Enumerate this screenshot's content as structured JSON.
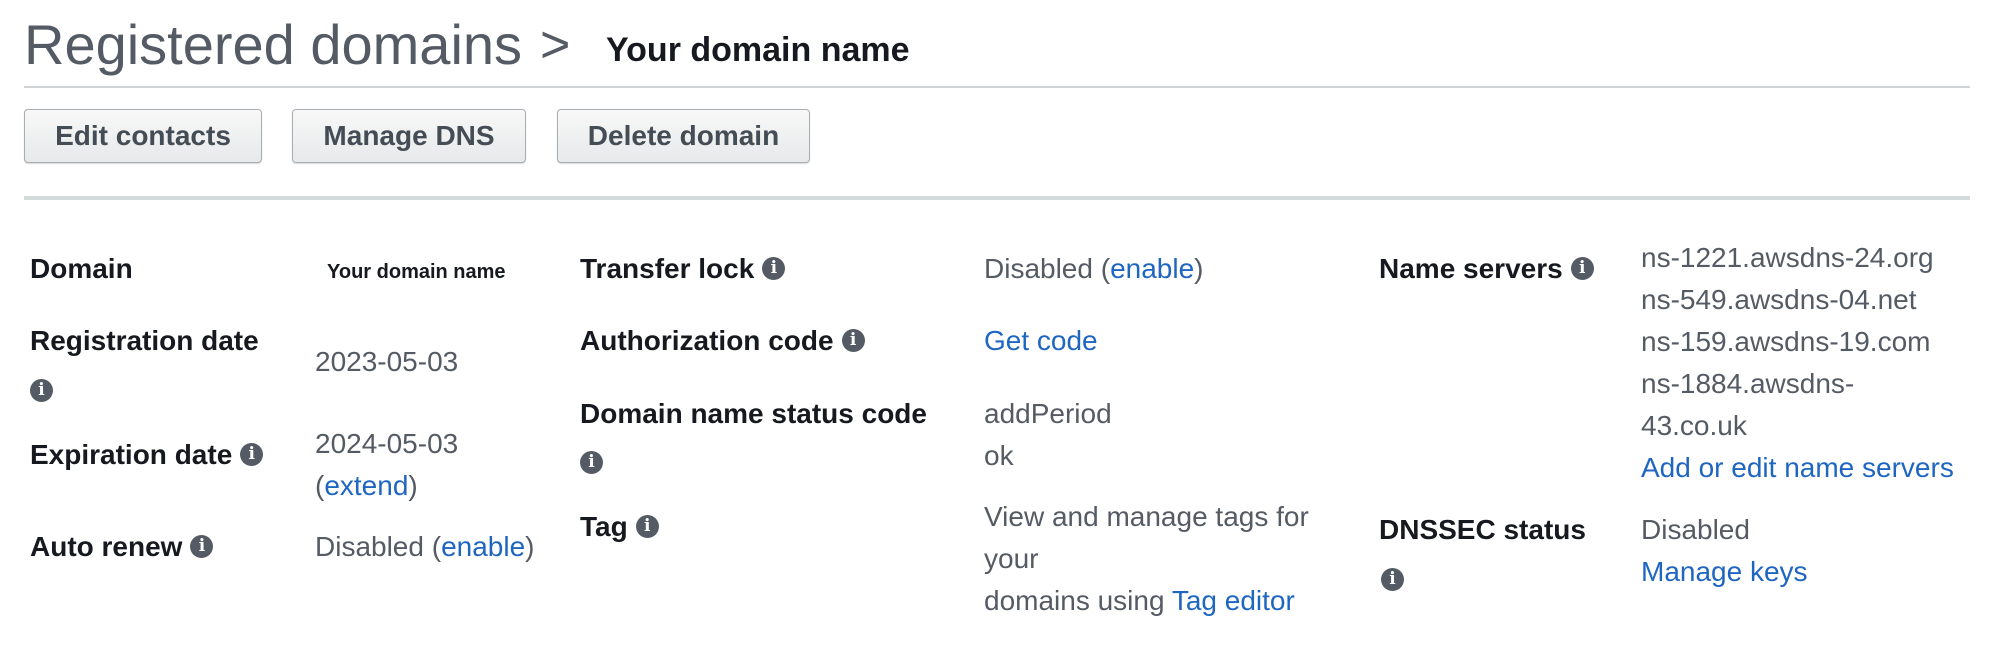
{
  "breadcrumb": {
    "root": "Registered domains",
    "separator": ">",
    "current": "Your domain name"
  },
  "toolbar": {
    "edit_contacts": "Edit contacts",
    "manage_dns": "Manage DNS",
    "delete_domain": "Delete domain"
  },
  "icons": {
    "info": "info-icon",
    "info_glyph": "i"
  },
  "colors": {
    "link": "#1f66c1",
    "label": "#16191f",
    "value": "#545b64",
    "button_text": "#444c55"
  },
  "col1": {
    "domain": {
      "label": "Domain",
      "value": "Your domain name"
    },
    "registration_date": {
      "label": "Registration date",
      "value": "2023-05-03"
    },
    "expiration_date": {
      "label": "Expiration date",
      "value": "2024-05-03",
      "paren_open": "(",
      "link": "extend",
      "paren_close": ")"
    },
    "auto_renew": {
      "label": "Auto renew",
      "value": "Disabled (",
      "link": "enable",
      "paren_close": ")"
    }
  },
  "col2": {
    "transfer_lock": {
      "label": "Transfer lock",
      "value": "Disabled (",
      "link": "enable",
      "paren_close": ")"
    },
    "authorization_code": {
      "label": "Authorization code",
      "link": "Get code"
    },
    "domain_status": {
      "label": "Domain name status code",
      "values": [
        "addPeriod",
        "ok"
      ]
    },
    "tag": {
      "label": "Tag",
      "text_line1": "View and manage tags for",
      "text_line2": "your",
      "text_line3": "domains using",
      "link": "Tag editor"
    }
  },
  "col3": {
    "name_servers": {
      "label": "Name servers",
      "servers": [
        "ns-1221.awsdns-24.org",
        "ns-549.awsdns-04.net",
        "ns-159.awsdns-19.com",
        "ns-1884.awsdns-",
        "43.co.uk"
      ],
      "link": "Add or edit name servers"
    },
    "dnssec": {
      "label": "DNSSEC status",
      "value": "Disabled",
      "link": "Manage keys"
    }
  }
}
